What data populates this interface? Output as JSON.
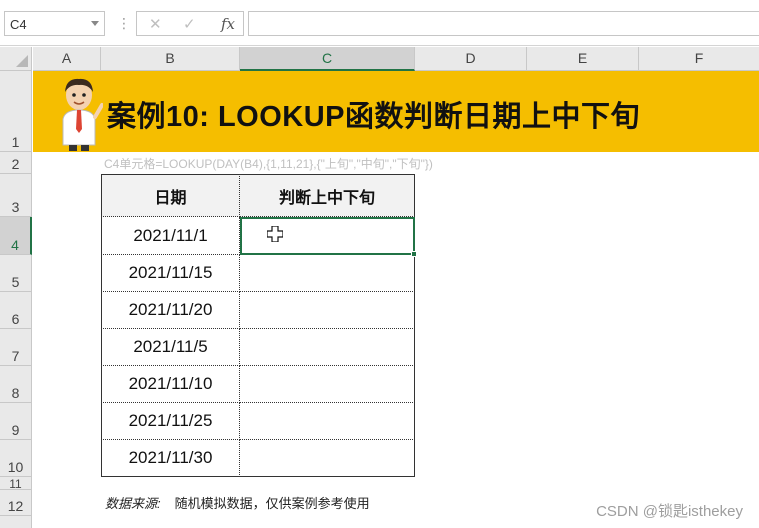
{
  "formula_bar": {
    "name_box": "C4",
    "cancel_glyph": "✕",
    "enter_glyph": "✓",
    "fx_label": "fx",
    "formula_value": ""
  },
  "columns": [
    "A",
    "B",
    "C",
    "D",
    "E",
    "F"
  ],
  "selected_column": "C",
  "rows": [
    "1",
    "2",
    "3",
    "4",
    "5",
    "6",
    "7",
    "8",
    "9",
    "10",
    "11",
    "12"
  ],
  "selected_row": "4",
  "banner": {
    "title": "案例10: LOOKUP函数判断日期上中下旬",
    "background": "#f5be00"
  },
  "formula_note": "C4单元格=LOOKUP(DAY(B4),{1,11,21},{\"上旬\",\"中旬\",\"下旬\"})",
  "table": {
    "headers": [
      "日期",
      "判断上中下旬"
    ],
    "dates": [
      "2021/11/1",
      "2021/11/15",
      "2021/11/20",
      "2021/11/5",
      "2021/11/10",
      "2021/11/25",
      "2021/11/30"
    ],
    "results": [
      "",
      "",
      "",
      "",
      "",
      "",
      ""
    ]
  },
  "source": {
    "label": "数据来源:",
    "text": "随机模拟数据，仅供案例参考使用"
  },
  "watermark": "CSDN @锁匙isthekey",
  "colors": {
    "accent": "#217346",
    "header_bg": "#e9e9e9"
  }
}
